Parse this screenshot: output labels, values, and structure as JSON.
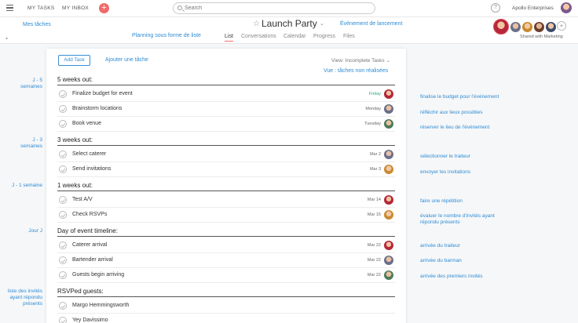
{
  "topbar": {
    "my_tasks": "MY TASKS",
    "my_inbox": "MY INBOX",
    "plus": "+",
    "search_placeholder": "Search",
    "help": "?",
    "org": "Apollo Enterprises"
  },
  "header": {
    "annotation_left": "Mes tâches",
    "title": "Launch Party",
    "title_annotation": "Événement de lancement",
    "tabs_annotation": "Planning sous forme de liste",
    "tabs": [
      "List",
      "Conversations",
      "Calendar",
      "Progress",
      "Files"
    ],
    "shared": "Shared with Marketing",
    "add_member": "+"
  },
  "toolbar": {
    "add_task": "Add Task",
    "add_task_annotation": "Ajouter une tâche",
    "view": "View: Incomplete Tasks",
    "view_annotation": "Vue : tâches non réalisées"
  },
  "sections": [
    {
      "title": "5 weeks out:",
      "left_annotation": "J - 5 semaines",
      "tasks": [
        {
          "name": "Finalize budget for event",
          "due": "Friday",
          "annotation": "finalise le budget pour l'événement"
        },
        {
          "name": "Brainstorm locations",
          "due": "Monday",
          "annotation": "réfléchir aux lieux possibles"
        },
        {
          "name": "Book venue",
          "due": "Tuesday",
          "annotation": "réserver le lieu de l'événement"
        }
      ]
    },
    {
      "title": "3 weeks out:",
      "left_annotation": "J - 3 semaines",
      "tasks": [
        {
          "name": "Select caterer",
          "due": "Mar 2",
          "annotation": "sélectionner le traiteur"
        },
        {
          "name": "Send invitations",
          "due": "Mar 3",
          "annotation": "envoyer les invitations"
        }
      ]
    },
    {
      "title": "1 weeks out:",
      "left_annotation": "J - 1 semaine",
      "tasks": [
        {
          "name": "Test A/V",
          "due": "Mar 14",
          "annotation": "faire une répétition"
        },
        {
          "name": "Check RSVPs",
          "due": "Mar 15",
          "annotation": "évaluer le nombre d'invités ayant répondu présents"
        }
      ]
    },
    {
      "title": "Day of event timeline:",
      "left_annotation": "Jour J",
      "tasks": [
        {
          "name": "Caterer arrival",
          "due": "Mar 22",
          "annotation": "arrivée du traiteur"
        },
        {
          "name": "Bartender arrival",
          "due": "Mar 22",
          "annotation": "arrivée du barman"
        },
        {
          "name": "Guests begin arriving",
          "due": "Mar 22",
          "annotation": "arrivée des premiers invités"
        }
      ]
    },
    {
      "title": "RSVPed guests:",
      "left_annotation": "liste des invités ayant répondu présents",
      "tasks": [
        {
          "name": "Margo Hemmingsworth",
          "due": ""
        },
        {
          "name": "Yey Davissimo",
          "due": ""
        }
      ]
    }
  ],
  "colors": {
    "accent": "#2d8cd6",
    "brand": "#f06a6a",
    "green": "#27b07a"
  }
}
